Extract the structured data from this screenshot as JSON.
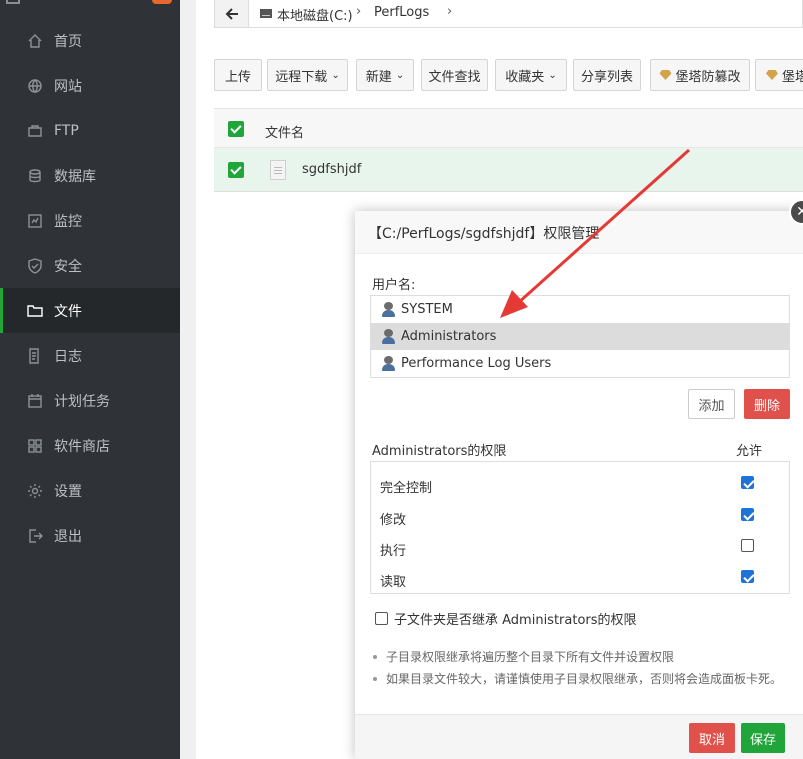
{
  "sidebar": {
    "items": [
      {
        "label": "首页",
        "icon": "home-icon"
      },
      {
        "label": "网站",
        "icon": "globe-icon"
      },
      {
        "label": "FTP",
        "icon": "ftp-icon"
      },
      {
        "label": "数据库",
        "icon": "database-icon"
      },
      {
        "label": "监控",
        "icon": "monitor-icon"
      },
      {
        "label": "安全",
        "icon": "shield-icon"
      },
      {
        "label": "文件",
        "icon": "folder-icon",
        "active": true
      },
      {
        "label": "日志",
        "icon": "log-icon"
      },
      {
        "label": "计划任务",
        "icon": "calendar-icon"
      },
      {
        "label": "软件商店",
        "icon": "apps-icon"
      },
      {
        "label": "设置",
        "icon": "gear-icon"
      },
      {
        "label": "退出",
        "icon": "logout-icon"
      }
    ]
  },
  "pathbar": {
    "crumbs": [
      "本地磁盘(C:)",
      "PerfLogs"
    ]
  },
  "toolbar": {
    "upload": "上传",
    "remote_download": "远程下载",
    "new": "新建",
    "file_search": "文件查找",
    "favorites": "收藏夹",
    "share_list": "分享列表",
    "tamper_proof": "堡塔防篡改",
    "tamper_proof_2": "堡塔"
  },
  "file_table": {
    "header": "文件名",
    "rows": [
      {
        "name": "sgdfshjdf",
        "checked": true
      }
    ]
  },
  "dialog": {
    "title": "【C:/PerfLogs/sgdfshjdf】权限管理",
    "username_label": "用户名:",
    "users": [
      {
        "name": "SYSTEM",
        "selected": false
      },
      {
        "name": "Administrators",
        "selected": true
      },
      {
        "name": "Performance Log Users",
        "selected": false
      }
    ],
    "add_button": "添加",
    "delete_button": "删除",
    "perm_title": "Administrators的权限",
    "allow_label": "允许",
    "permissions": [
      {
        "name": "完全控制",
        "allowed": true
      },
      {
        "name": "修改",
        "allowed": true
      },
      {
        "name": "执行",
        "allowed": false
      },
      {
        "name": "读取",
        "allowed": true
      }
    ],
    "inherit_label": "子文件夹是否继承 Administrators的权限",
    "inherit_checked": false,
    "notes": [
      "子目录权限继承将遍历整个目录下所有文件并设置权限",
      "如果目录文件较大，请谨慎使用子目录权限继承，否则将会造成面板卡死。"
    ],
    "cancel_button": "取消",
    "save_button": "保存"
  },
  "colors": {
    "sidebar_bg": "#2f3337",
    "accent_green": "#20a53a",
    "danger_red": "#e0514b",
    "arrow_red": "#e53935"
  }
}
